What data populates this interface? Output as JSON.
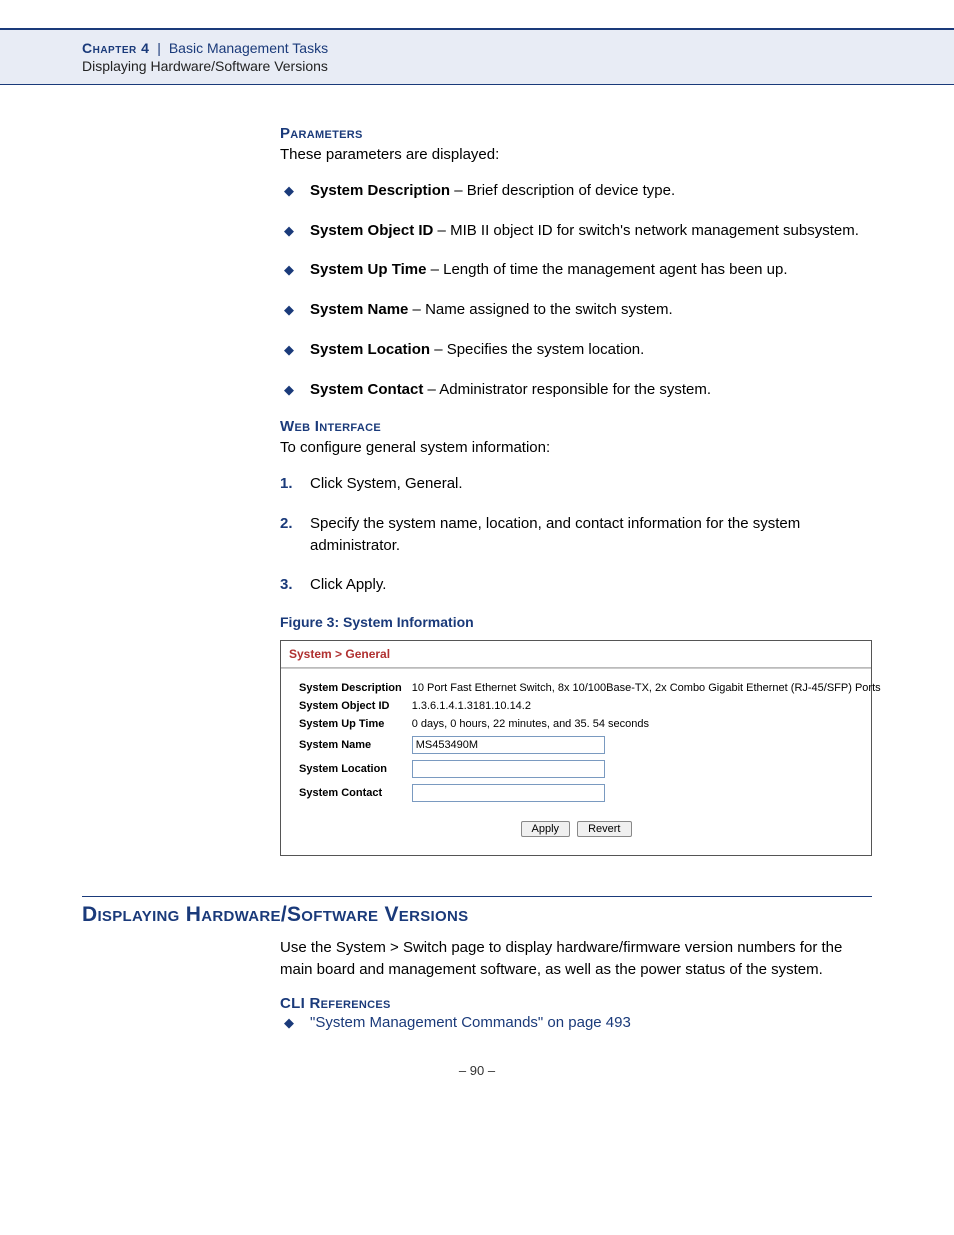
{
  "header": {
    "chapter": "Chapter 4",
    "separator": "|",
    "title": "Basic Management Tasks",
    "subtitle": "Displaying Hardware/Software Versions"
  },
  "sections": {
    "parameters": {
      "heading": "Parameters",
      "intro": "These parameters are displayed:",
      "items": [
        {
          "term": "System Description",
          "desc": " – Brief description of device type."
        },
        {
          "term": "System Object ID",
          "desc": " – MIB II object ID for switch's network management subsystem."
        },
        {
          "term": "System Up Time",
          "desc": " – Length of time the management agent has been up."
        },
        {
          "term": "System Name",
          "desc": " – Name assigned to the switch system."
        },
        {
          "term": "System Location",
          "desc": " – Specifies the system location."
        },
        {
          "term": "System Contact",
          "desc": " – Administrator responsible for the system."
        }
      ]
    },
    "webinterface": {
      "heading": "Web Interface",
      "intro": "To configure general system information:",
      "steps": [
        "Click System, General.",
        "Specify the system name, location, and contact information for the system administrator.",
        "Click Apply."
      ]
    },
    "figure": {
      "caption": "Figure 3:  System Information",
      "breadcrumb": "System > General",
      "rows": {
        "desc_label": "System Description",
        "desc_value": "10 Port Fast Ethernet Switch, 8x 10/100Base-TX, 2x Combo Gigabit Ethernet (RJ-45/SFP) Ports",
        "oid_label": "System Object ID",
        "oid_value": "1.3.6.1.4.1.3181.10.14.2",
        "uptime_label": "System Up Time",
        "uptime_value": "0 days, 0 hours, 22 minutes, and 35. 54 seconds",
        "name_label": "System Name",
        "name_value": "MS453490M",
        "loc_label": "System Location",
        "loc_value": "",
        "contact_label": "System Contact",
        "contact_value": ""
      },
      "buttons": {
        "apply": "Apply",
        "revert": "Revert"
      }
    },
    "versions": {
      "heading": "Displaying Hardware/Software Versions",
      "intro": "Use the System > Switch page to display hardware/firmware version numbers for the main board and management software, as well as the power status of the system.",
      "cli_heading": "CLI References",
      "cli_link": "\"System Management Commands\" on page 493"
    }
  },
  "pagenum": "–  90  –"
}
